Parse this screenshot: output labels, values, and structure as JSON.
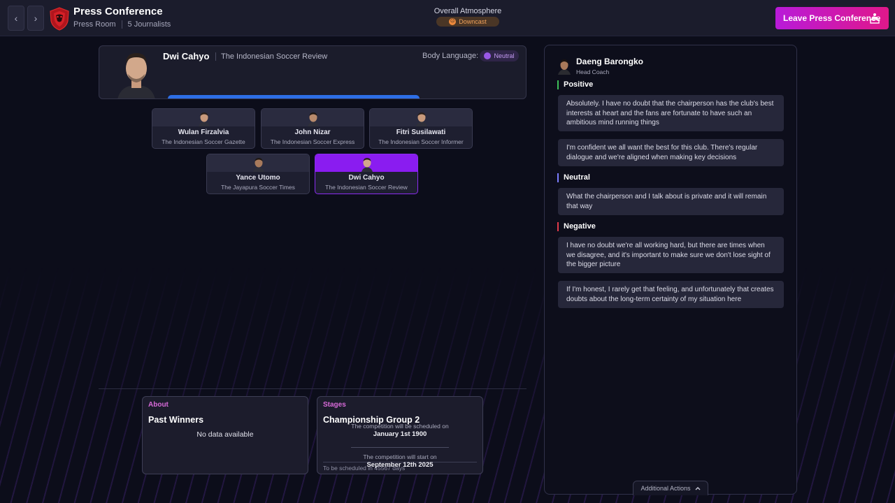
{
  "colors": {
    "accent": "#8a1cf0",
    "leave_gradient_start": "#b81ad9",
    "leave_gradient_end": "#e0188a",
    "positive": "#3dbf58",
    "neutral": "#7a7cff",
    "negative": "#e03a4a",
    "atmosphere": "#f08a3c",
    "section_header": "#d86ad9"
  },
  "header": {
    "title": "Press Conference",
    "location": "Press Room",
    "journalist_count": "5 Journalists",
    "back_icon": "chevron-left-icon",
    "forward_icon": "chevron-right-icon",
    "crest_icon": "club-crest-icon",
    "atmosphere": {
      "label": "Overall Atmosphere",
      "value": "Downcast",
      "icon": "sad-face-icon"
    },
    "leave_button": {
      "label": "Leave Press Conference",
      "icon": "podium-icon"
    }
  },
  "current_journalist": {
    "name": "Dwi Cahyo",
    "publication": "The Indonesian Soccer Review",
    "body_language_label": "Body Language:",
    "body_language_value": "Neutral"
  },
  "journalists": [
    {
      "name": "Wulan Firzalvia",
      "publication": "The Indonesian Soccer Gazette",
      "active": false
    },
    {
      "name": "John Nizar",
      "publication": "The Indonesian Soccer Express",
      "active": false
    },
    {
      "name": "Fitri Susilawati",
      "publication": "The Indonesian Soccer Informer",
      "active": false
    },
    {
      "name": "Yance Utomo",
      "publication": "The Jayapura Soccer Times",
      "active": false
    },
    {
      "name": "Dwi Cahyo",
      "publication": "The Indonesian Soccer Review",
      "active": true
    }
  ],
  "about_card": {
    "header": "About",
    "title": "Past Winners",
    "empty_text": "No data available"
  },
  "stages_card": {
    "header": "Stages",
    "title": "Championship Group 2",
    "scheduled_label": "The competition will be scheduled on",
    "scheduled_date": "January 1st 1900",
    "start_label": "The competition will start on",
    "start_date": "September 12th 2025",
    "footer": "To be scheduled in 45567 days"
  },
  "responder": {
    "name": "Daeng Barongko",
    "role": "Head Coach"
  },
  "responses": {
    "positive_label": "Positive",
    "positive": [
      "Absolutely. I have no doubt that the chairperson has the club's best interests at heart and the fans are fortunate to have such an ambitious mind running things",
      "I'm confident we all want the best for this club. There's regular dialogue and we're aligned when making key decisions"
    ],
    "neutral_label": "Neutral",
    "neutral": [
      "What the chairperson and I talk about is private and it will remain that way"
    ],
    "negative_label": "Negative",
    "negative": [
      "I have no doubt we're all working hard, but there are times when we disagree, and it's important to make sure we don't lose sight of the bigger picture",
      "If I'm honest, I rarely get that feeling, and unfortunately that creates doubts about the long-term certainty of my situation here"
    ]
  },
  "additional_actions": {
    "label": "Additional Actions",
    "icon": "chevron-up-icon"
  }
}
